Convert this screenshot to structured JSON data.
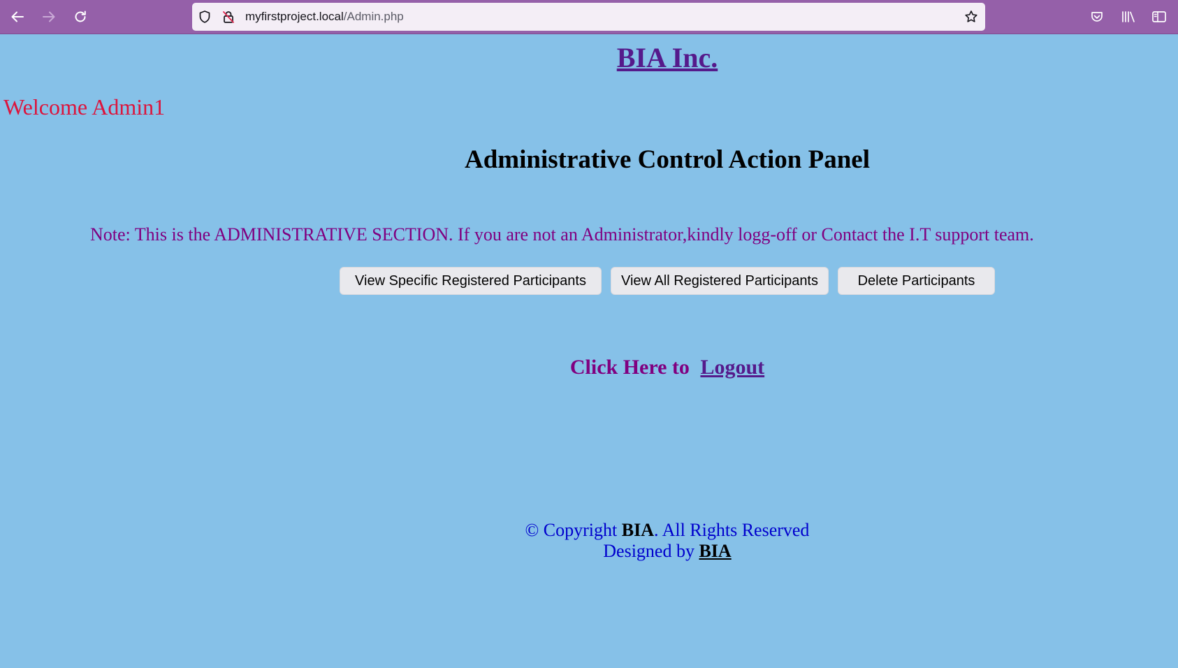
{
  "browser": {
    "url_host": "myfirstproject.local",
    "url_path": "/Admin.php",
    "colors": {
      "toolbar": "#9560a9",
      "urlbar": "#f4eef6"
    },
    "icons": [
      "back-arrow-icon",
      "forward-arrow-icon",
      "reload-icon",
      "shield-icon",
      "insecure-lock-icon",
      "bookmark-star-icon",
      "pocket-icon",
      "library-icon",
      "sidebar-icon"
    ]
  },
  "page": {
    "brand": "BIA Inc.",
    "welcome": "Welcome Admin1",
    "panel_title": "Administrative Control Action Panel",
    "note": "Note: This is the ADMINISTRATIVE SECTION. If you are not an Administrator,kindly logg-off or Contact the I.T support team.",
    "buttons": {
      "view_specific": "View Specific Registered Participants",
      "view_all": "View All Registered Participants",
      "delete": "Delete Participants"
    },
    "logout": {
      "prefix": "Click Here to",
      "link": "Logout"
    },
    "footer": {
      "copyright_prefix": "© Copyright",
      "copyright_brand": "BIA",
      "copyright_suffix": ". All Rights Reserved",
      "designed_prefix": "Designed by",
      "designed_brand": "BIA"
    },
    "colors": {
      "background": "#86c1e8",
      "welcome": "#dc143c",
      "note": "#800080",
      "link": "#551a8b",
      "footer": "#0000cd"
    }
  }
}
